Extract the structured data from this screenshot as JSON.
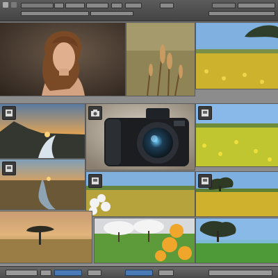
{
  "window": {
    "title": ""
  },
  "toolbar": {
    "controls": [
      "",
      "",
      "",
      "",
      "",
      "",
      "",
      "",
      ""
    ]
  },
  "grid": {
    "tiles": [
      {
        "subject": "portrait-woman"
      },
      {
        "subject": "wheat-stalks"
      },
      {
        "subject": "yellow-flower-field-tree"
      },
      {
        "subject": "sunset-mountain-river"
      },
      {
        "subject": "camera"
      },
      {
        "subject": "yellow-field-blue-sky"
      },
      {
        "subject": "plains-sunset-road"
      },
      {
        "subject": "white-flowers-field"
      },
      {
        "subject": "field-with-tree"
      },
      {
        "subject": "savanna-acacia-tree"
      },
      {
        "subject": "blossom-trees-orange-flowers"
      },
      {
        "subject": "green-meadow-tree"
      }
    ]
  },
  "colors": {
    "chrome": "#4c4c4c",
    "sky": "#8cb9e6",
    "field_yellow": "#d8c13a",
    "field_green": "#4f9a38",
    "sunset": "#f2a443",
    "accent_blue": "#4a7bb6"
  },
  "icons": [
    "camera-badge-icon",
    "image-badge-icon"
  ]
}
